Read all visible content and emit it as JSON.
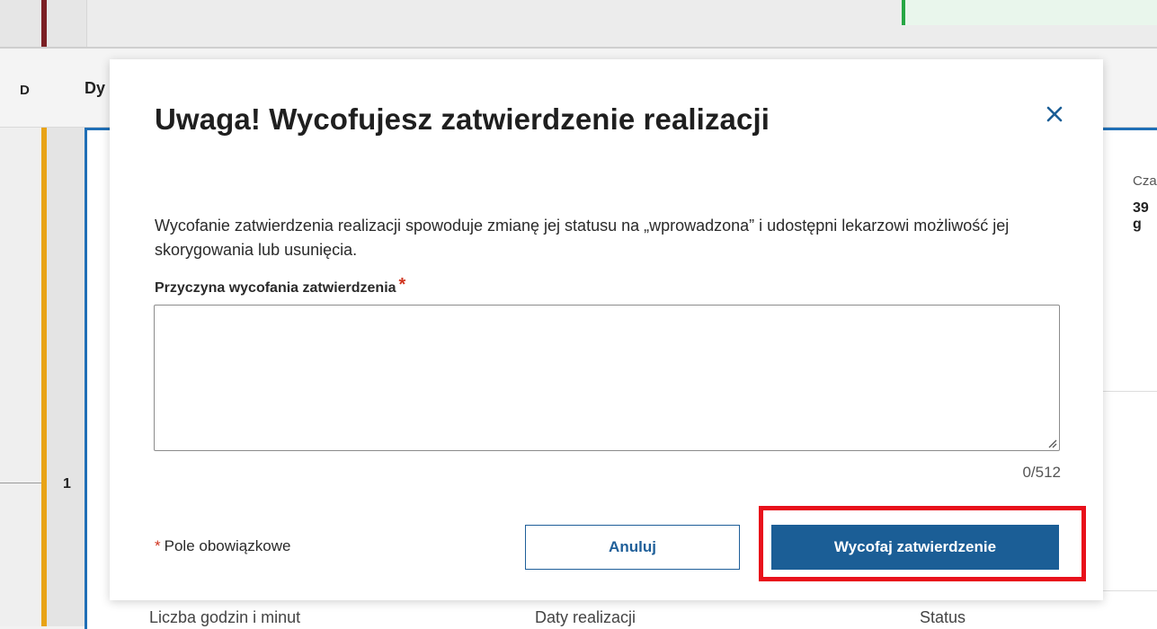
{
  "background": {
    "header": {
      "col_d": "D",
      "col_dy": "Dy"
    },
    "row_number": "1",
    "right_panel": {
      "label": "Cza",
      "value": "39 g"
    },
    "columns": [
      "Liczba godzin i minut",
      "Daty realizacji",
      "Status"
    ],
    "colors": {
      "accent_blue": "#1f6fb6",
      "row_yellow": "#e8a317",
      "status_green": "#27a744",
      "dark_red": "#7a1f24"
    }
  },
  "modal": {
    "title": "Uwaga! Wycofujesz zatwierdzenie realizacji",
    "close_icon": "close-icon",
    "description": "Wycofanie zatwierdzenia realizacji spowoduje zmianę jej statusu na „wprowadzona” i udostępni lekarzowi możliwość jej skorygowania lub usunięcia.",
    "field_label": "Przyczyna wycofania zatwierdzenia",
    "required_mark": "*",
    "input_value": "",
    "counter": "0/512",
    "required_note_mark": "*",
    "required_note": "Pole obowiązkowe",
    "cancel_label": "Anuluj",
    "confirm_label": "Wycofaj zatwierdzenie",
    "colors": {
      "primary": "#1b5e96",
      "required": "#d0341f",
      "highlight": "#e8101b"
    }
  }
}
